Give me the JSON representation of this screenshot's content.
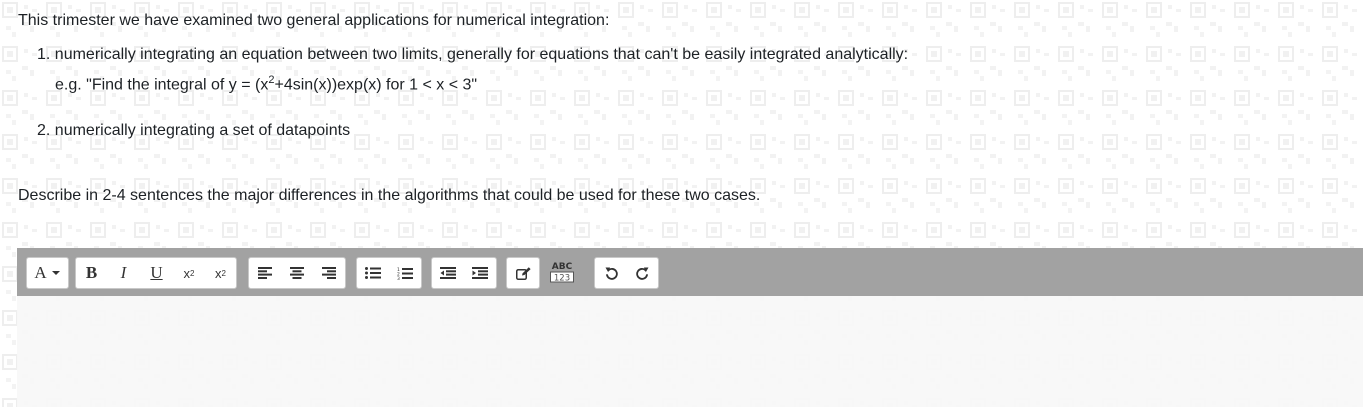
{
  "intro": "This trimester we have examined two general applications for numerical integration:",
  "items": [
    {
      "number": "1.",
      "text": "numerically integrating an equation between two limits, generally for equations that can't be easily integrated analytically:",
      "example_prefix": "e.g. \"Find the integral of y = (x",
      "example_sup": "2",
      "example_suffix": "+4sin(x))exp(x) for 1 < x < 3\""
    },
    {
      "number": "2.",
      "text": "numerically integrating a set of datapoints"
    }
  ],
  "question": "Describe in 2-4 sentences the major differences in the algorithms that could be used for these two cases.",
  "toolbar": {
    "font": "A",
    "bold": "B",
    "italic": "I",
    "underline": "U",
    "subscript": "x",
    "subscript_sub": "2",
    "superscript": "x",
    "superscript_sup": "2",
    "spell_top": "ABC",
    "spell_bottom": "123"
  },
  "colors": {
    "toolbar_bg": "#a2a2a2",
    "editor_bg": "#f7f7f7",
    "text": "#1d2125"
  }
}
